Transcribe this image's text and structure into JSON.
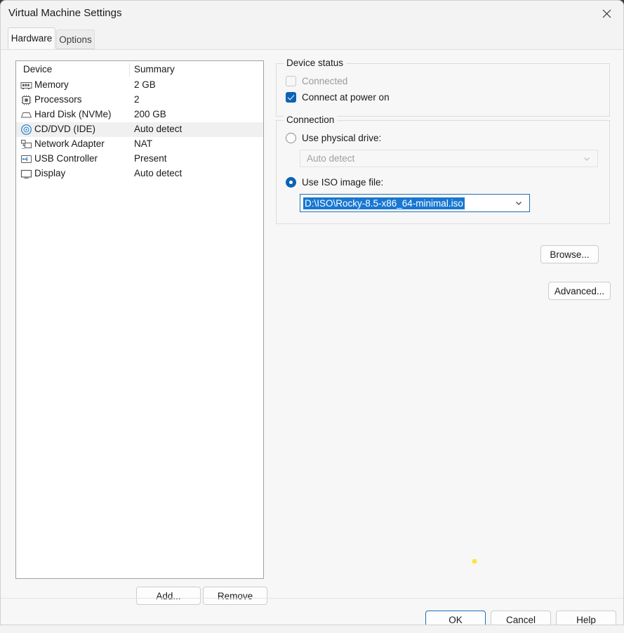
{
  "window": {
    "title": "Virtual Machine Settings",
    "close_icon": "close-icon"
  },
  "tabs": [
    {
      "label": "Hardware",
      "selected": true
    },
    {
      "label": "Options",
      "selected": false
    }
  ],
  "device_list": {
    "columns": [
      "Device",
      "Summary"
    ],
    "rows": [
      {
        "icon": "memory-icon",
        "label": "Memory",
        "summary": "2 GB",
        "selected": false
      },
      {
        "icon": "processor-icon",
        "label": "Processors",
        "summary": "2",
        "selected": false
      },
      {
        "icon": "hard-disk-icon",
        "label": "Hard Disk (NVMe)",
        "summary": "200 GB",
        "selected": false
      },
      {
        "icon": "cd-dvd-icon",
        "label": "CD/DVD (IDE)",
        "summary": "Auto detect",
        "selected": true
      },
      {
        "icon": "network-adapter-icon",
        "label": "Network Adapter",
        "summary": "NAT",
        "selected": false
      },
      {
        "icon": "usb-controller-icon",
        "label": "USB Controller",
        "summary": "Present",
        "selected": false
      },
      {
        "icon": "display-icon",
        "label": "Display",
        "summary": "Auto detect",
        "selected": false
      }
    ],
    "add_label": "Add...",
    "remove_label": "Remove"
  },
  "device_status": {
    "legend": "Device status",
    "connected": {
      "label": "Connected",
      "checked": false,
      "disabled": true
    },
    "connect_at_power_on": {
      "label": "Connect at power on",
      "checked": true,
      "disabled": false
    }
  },
  "connection": {
    "legend": "Connection",
    "use_physical_drive": {
      "label": "Use physical drive:",
      "selected": false
    },
    "physical_drive_value": "Auto detect",
    "use_iso_image": {
      "label": "Use ISO image file:",
      "selected": true
    },
    "iso_path": "D:\\ISO\\Rocky-8.5-x86_64-minimal.iso",
    "browse_label": "Browse...",
    "advanced_label": "Advanced..."
  },
  "footer": {
    "ok_label": "OK",
    "cancel_label": "Cancel",
    "help_label": "Help"
  },
  "colors": {
    "accent": "#0a64b4",
    "selection_highlight": "#1877d1",
    "focus_border": "#1f6eb8",
    "row_selected_bg": "#f0f0f0",
    "cursor_dot": "#ffe23a"
  }
}
